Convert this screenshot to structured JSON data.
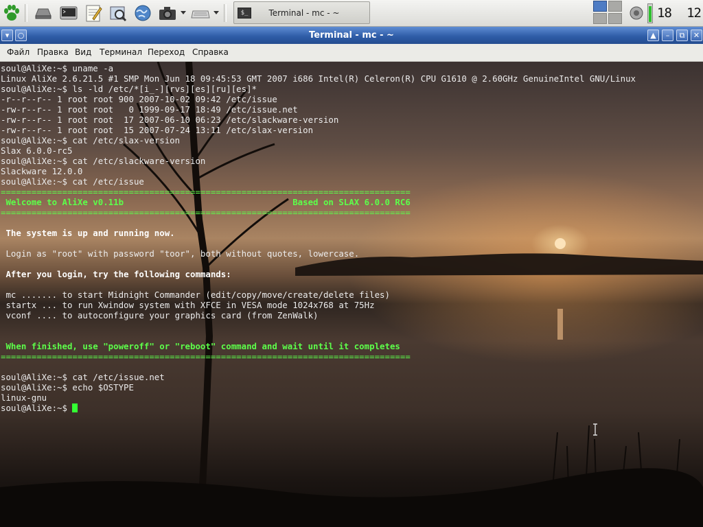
{
  "panel": {
    "launchers": [
      {
        "icon": "paw-menu-icon"
      },
      {
        "icon": "show-desktop-icon"
      },
      {
        "icon": "terminal-launcher-icon"
      },
      {
        "icon": "text-editor-icon"
      },
      {
        "icon": "file-search-icon"
      },
      {
        "icon": "web-browser-icon"
      },
      {
        "icon": "camera-screenshot-icon"
      },
      {
        "icon": "keyboard-layout-icon"
      }
    ],
    "task": {
      "label": "Terminal - mc - ~",
      "icon": "terminal-task-icon"
    },
    "clock": {
      "hours": "18",
      "minutes": "12"
    },
    "workspaces": {
      "count": 4,
      "active": 1
    }
  },
  "window": {
    "title": "Terminal - mc - ~",
    "buttons": [
      "menu",
      "stick",
      "shade",
      "minimize",
      "maximize",
      "close"
    ]
  },
  "menu": {
    "items": [
      {
        "label": "Файл"
      },
      {
        "label": "Правка"
      },
      {
        "label": "Вид"
      },
      {
        "label": "Терминал"
      },
      {
        "label": "Переход"
      },
      {
        "label": "Справка"
      }
    ]
  },
  "terminal": {
    "lines": [
      {
        "text": "soul@AliXe:~$ uname -a",
        "style": ""
      },
      {
        "text": "Linux AliXe 2.6.21.5 #1 SMP Mon Jun 18 09:45:53 GMT 2007 i686 Intel(R) Celeron(R) CPU G1610 @ 2.60GHz GenuineIntel GNU/Linux",
        "style": ""
      },
      {
        "text": "soul@AliXe:~$ ls -ld /etc/*[i_-][rvs][es][ru][es]*",
        "style": ""
      },
      {
        "text": "-r--r--r-- 1 root root 900 2007-10-02 09:42 /etc/issue",
        "style": ""
      },
      {
        "text": "-rw-r--r-- 1 root root   0 1999-09-17 18:49 /etc/issue.net",
        "style": ""
      },
      {
        "text": "-rw-r--r-- 1 root root  17 2007-06-10 06:23 /etc/slackware-version",
        "style": ""
      },
      {
        "text": "-rw-r--r-- 1 root root  15 2007-07-24 13:11 /etc/slax-version",
        "style": ""
      },
      {
        "text": "soul@AliXe:~$ cat /etc/slax-version",
        "style": ""
      },
      {
        "text": "Slax 6.0.0-rc5",
        "style": ""
      },
      {
        "text": "soul@AliXe:~$ cat /etc/slackware-version",
        "style": ""
      },
      {
        "text": "Slackware 12.0.0",
        "style": ""
      },
      {
        "text": "soul@AliXe:~$ cat /etc/issue",
        "style": ""
      },
      {
        "text": "================================================================================",
        "style": "g"
      },
      {
        "text": " Welcome to AliXe v0.11b                                 Based on SLAX 6.0.0 RC6",
        "style": "gb"
      },
      {
        "text": "================================================================================",
        "style": "g"
      },
      {
        "text": "",
        "style": ""
      },
      {
        "text": " The system is up and running now.",
        "style": "wb"
      },
      {
        "text": "",
        "style": ""
      },
      {
        "text": " Login as \"root\" with password \"toor\", both without quotes, lowercase.",
        "style": ""
      },
      {
        "text": "",
        "style": ""
      },
      {
        "text": " After you login, try the following commands:",
        "style": "wb"
      },
      {
        "text": "",
        "style": ""
      },
      {
        "text": " mc ....... to start Midnight Commander (edit/copy/move/create/delete files)",
        "style": ""
      },
      {
        "text": " startx ... to run Xwindow system with XFCE in VESA mode 1024x768 at 75Hz",
        "style": ""
      },
      {
        "text": " vconf .... to autoconfigure your graphics card (from ZenWalk)",
        "style": ""
      },
      {
        "text": "",
        "style": ""
      },
      {
        "text": "",
        "style": ""
      },
      {
        "text": " When finished, use \"poweroff\" or \"reboot\" command and wait until it completes",
        "style": "gb"
      },
      {
        "text": "================================================================================",
        "style": "g"
      },
      {
        "text": "",
        "style": ""
      },
      {
        "text": "soul@AliXe:~$ cat /etc/issue.net",
        "style": ""
      },
      {
        "text": "soul@AliXe:~$ echo $OSTYPE",
        "style": ""
      },
      {
        "text": "linux-gnu",
        "style": ""
      }
    ],
    "prompt": "soul@AliXe:~$ ",
    "cursor_color": "#33ff33",
    "text_color": "#ececec",
    "accent_green": "#5dff4a"
  }
}
